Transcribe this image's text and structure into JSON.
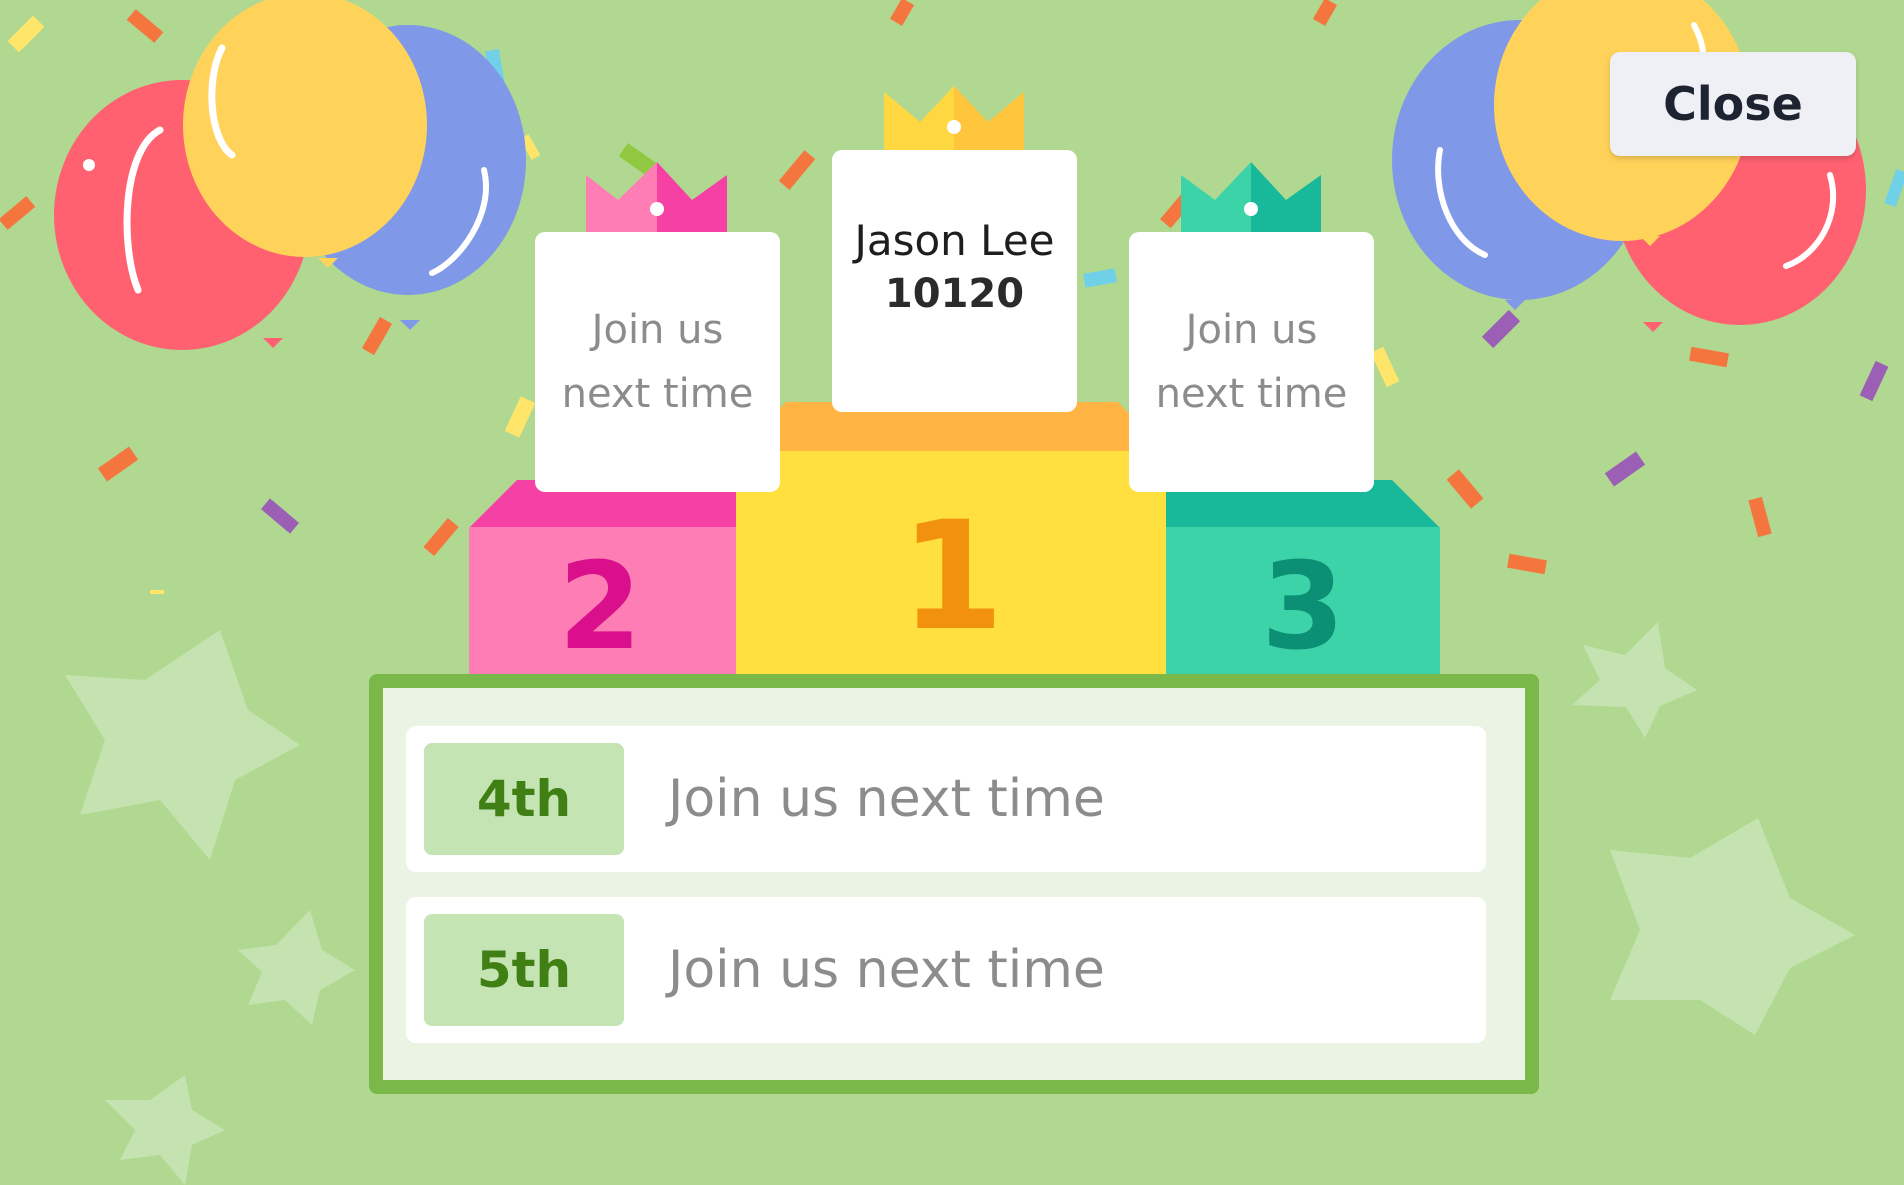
{
  "close_label": "Close",
  "podium": {
    "first": {
      "rank": "1",
      "name": "Jason Lee",
      "score": "10120"
    },
    "second": {
      "rank": "2",
      "message": "Join us next time"
    },
    "third": {
      "rank": "3",
      "message": "Join us next time"
    }
  },
  "leaderboard": [
    {
      "rank_label": "4th",
      "message": "Join us next time"
    },
    {
      "rank_label": "5th",
      "message": "Join us next time"
    }
  ],
  "colors": {
    "background": "#b1d890",
    "first_place": "#ffe03f",
    "second_place": "#ff7db5",
    "third_place": "#3cd3a8",
    "panel_border": "#7ab84a",
    "badge": "#c5e4b3"
  }
}
